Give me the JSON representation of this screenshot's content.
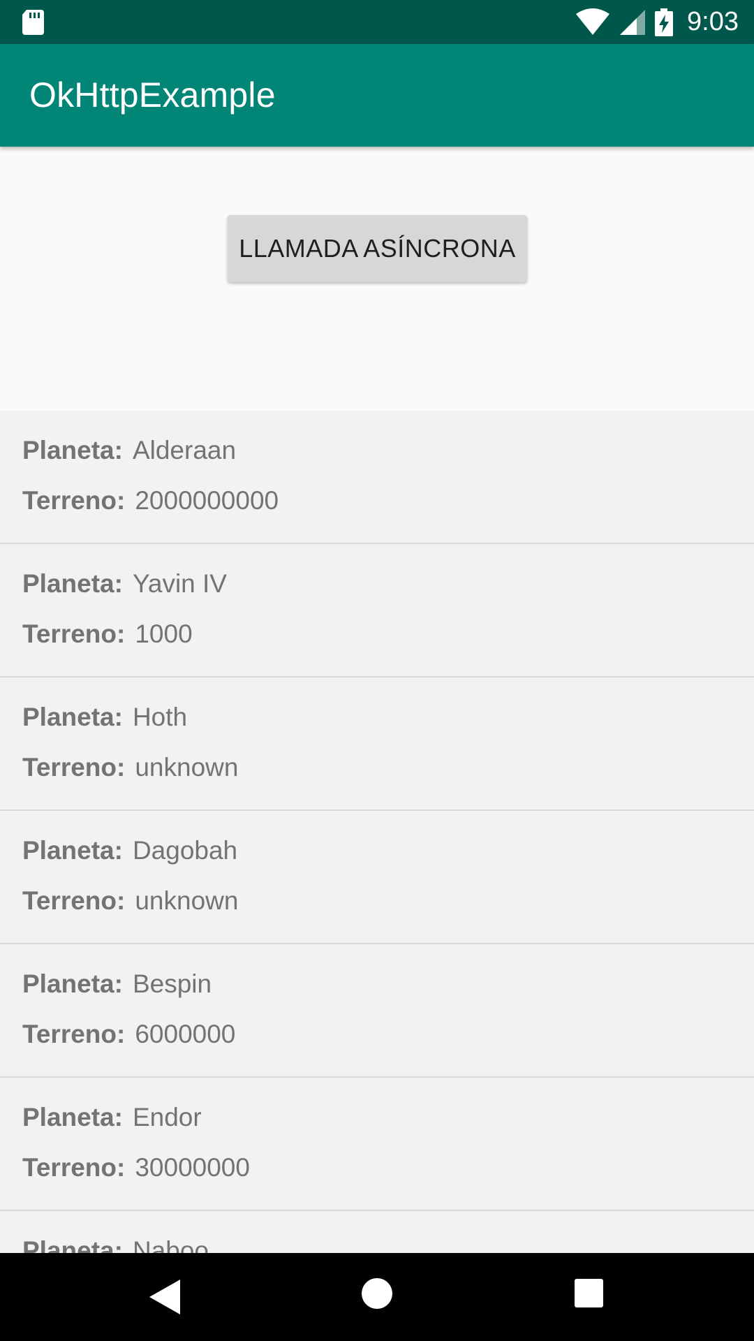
{
  "status_bar": {
    "time": "9:03",
    "icons": [
      "sd-card-icon",
      "wifi-icon",
      "cell-signal-icon",
      "battery-charging-icon"
    ]
  },
  "app_bar": {
    "title": "OkHttpExample"
  },
  "main": {
    "async_button_label": "LLAMADA ASÍNCRONA"
  },
  "list": {
    "planet_label": "Planeta:",
    "terrain_label": "Terreno:",
    "items": [
      {
        "planet": "Alderaan",
        "terrain": "2000000000"
      },
      {
        "planet": "Yavin IV",
        "terrain": "1000"
      },
      {
        "planet": "Hoth",
        "terrain": "unknown"
      },
      {
        "planet": "Dagobah",
        "terrain": "unknown"
      },
      {
        "planet": "Bespin",
        "terrain": "6000000"
      },
      {
        "planet": "Endor",
        "terrain": "30000000"
      },
      {
        "planet": "Naboo",
        "terrain": ""
      }
    ]
  },
  "nav_bar": {
    "icons": [
      "back-icon",
      "home-icon",
      "recent-apps-icon"
    ]
  },
  "colors": {
    "status_bar": "#00574b",
    "app_bar": "#008577",
    "button": "#d6d7d7",
    "list_background": "#f2f2f2",
    "text_secondary": "#737373"
  }
}
